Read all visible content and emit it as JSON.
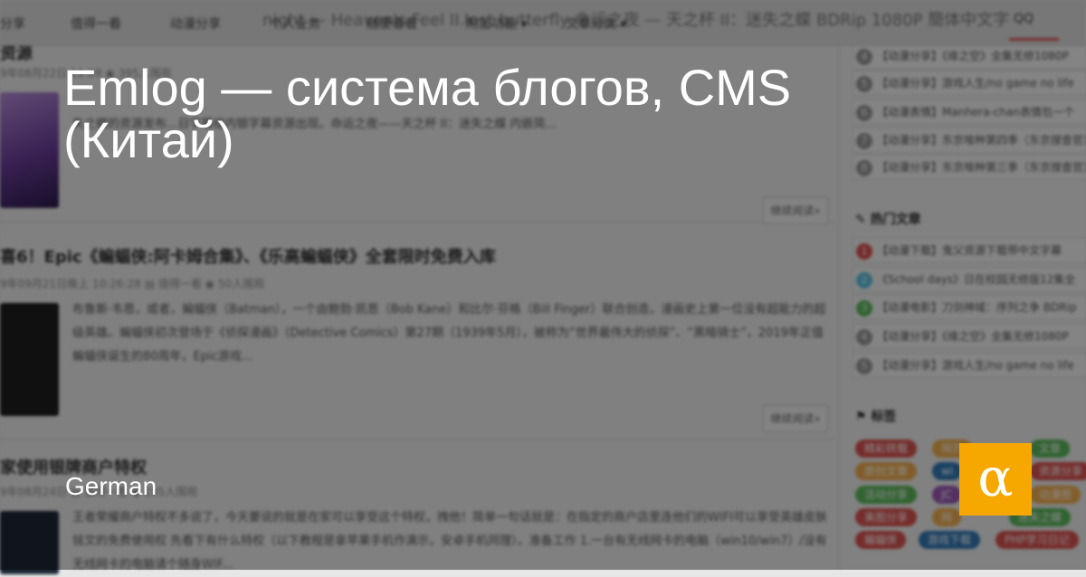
{
  "headline": "Emlog — система блогов, CMS (Китай)",
  "language": "German",
  "logo_glyph": "α",
  "background": {
    "nav": {
      "items": [
        "分享",
        "值得一看",
        "动漫分享",
        "个人业务",
        "随便看看",
        "附加功能 ▾",
        "文章分类 ▾"
      ],
      "title_fragment": "night — Heaven's Feel II.lost butterfly 命运之夜 — 天之杯 II：迷失之蝶 BDRip 1080P 簡体中文字",
      "qq": "QQ"
    },
    "posts": [
      {
        "title": "资源",
        "meta": "9年08月22日 11:28   ◉ 395人围观",
        "excerpt": "失之蝶的资源发布...日字幕组内银字幕资源出现。命运之夜——天之杯 II：迷失之蝶 内嵌简...",
        "more": "继续阅读»"
      },
      {
        "title": "喜6！Epic《蝙蝠侠:阿卡姆合集》、《乐高蝙蝠侠》全套限时免费入库",
        "meta": "9年09月21日晚上 10:26:28   ▤ 值得一看   ◉ 50人围观",
        "excerpt": "布鲁斯·韦恩，或者，蝙蝠侠（Batman），一个由鲍勃·凯恩（Bob Kane）和比尔·芬格（Bill Finger）联合创造，漫画史上第一位没有超能力的超级英雄。蝙蝠侠初次登场于《侦探漫画》（Detective Comics）第27期（1939年5月），被称为“世界最伟大的侦探”、“黑暗骑士”，2019年正值蝙蝠侠诞生的80周年，Epic游戏...",
        "more": "继续阅读»"
      },
      {
        "title": "家使用银牌商户特权",
        "meta": "9年08月24日   ▤ 值得一看   ◉ 195人围观",
        "excerpt": "王者荣耀商户特权不多说了，今天要说的就是在家可以享受这个特权，拽他！简单一句话就是：在指定的商户店里连他们的WIFI可以享受英雄皮肤铭文的免费使用权 先看下有什么特权（以下教程是拿苹果手机作演示，安卓手机同理）。准备工作 1.一台有无线网卡的电脑（win10/win7）/没有无线网卡的电脑请个随身WIF..."
      }
    ],
    "sidebar": {
      "top_list": [
        {
          "n": "4",
          "text": "【动漫分享】《缘之空》全集无修1080P"
        },
        {
          "n": "5",
          "text": "【动漫分享】游戏人生/no game no life"
        },
        {
          "n": "6",
          "text": "【动漫表情】Manhera-chan表情包一个"
        },
        {
          "n": "7",
          "text": "【动漫分享】东京喰种第四季（东京搜查官）"
        },
        {
          "n": "8",
          "text": "【动漫分享】东京喰种第三季（东京搜查官）"
        }
      ],
      "hot_head": "热门文章",
      "hot_list": [
        {
          "n": "1",
          "text": "【动漫下载】鬼父资源下载带中文字幕"
        },
        {
          "n": "2",
          "text": "《School days》日在校园无修版12集全"
        },
        {
          "n": "3",
          "text": "【动漫电影】刀剑神域：序列之争 BDRip"
        },
        {
          "n": "4",
          "text": "【动漫分享】《缘之空》全集无修1080P"
        },
        {
          "n": "5",
          "text": "【动漫分享】游戏人生/no game no life"
        }
      ],
      "tags_head": "标签",
      "tags": [
        {
          "text": "精彩转载",
          "color": "#d9534f"
        },
        {
          "text": "网页",
          "color": "#f0ad4e"
        },
        {
          "text": "文章",
          "color": "#5cb85c"
        },
        {
          "text": "原创文章",
          "color": "#f0ad4e"
        },
        {
          "text": "wi",
          "color": "#337ab7"
        },
        {
          "text": "资源分享",
          "color": "#d9534f"
        },
        {
          "text": "活动分享",
          "color": "#5cb85c"
        },
        {
          "text": "JC",
          "color": "#9b59b6"
        },
        {
          "text": "动漫图",
          "color": "#f0ad4e"
        },
        {
          "text": "美图分享",
          "color": "#d9534f"
        },
        {
          "text": "网",
          "color": "#f0ad4e"
        },
        {
          "text": "迷失之蝶",
          "color": "#5cb85c"
        },
        {
          "text": "蝙蝠侠",
          "color": "#d9534f"
        },
        {
          "text": "游戏下载",
          "color": "#337ab7"
        },
        {
          "text": "PHP学习日记",
          "color": "#d9534f"
        }
      ]
    }
  }
}
